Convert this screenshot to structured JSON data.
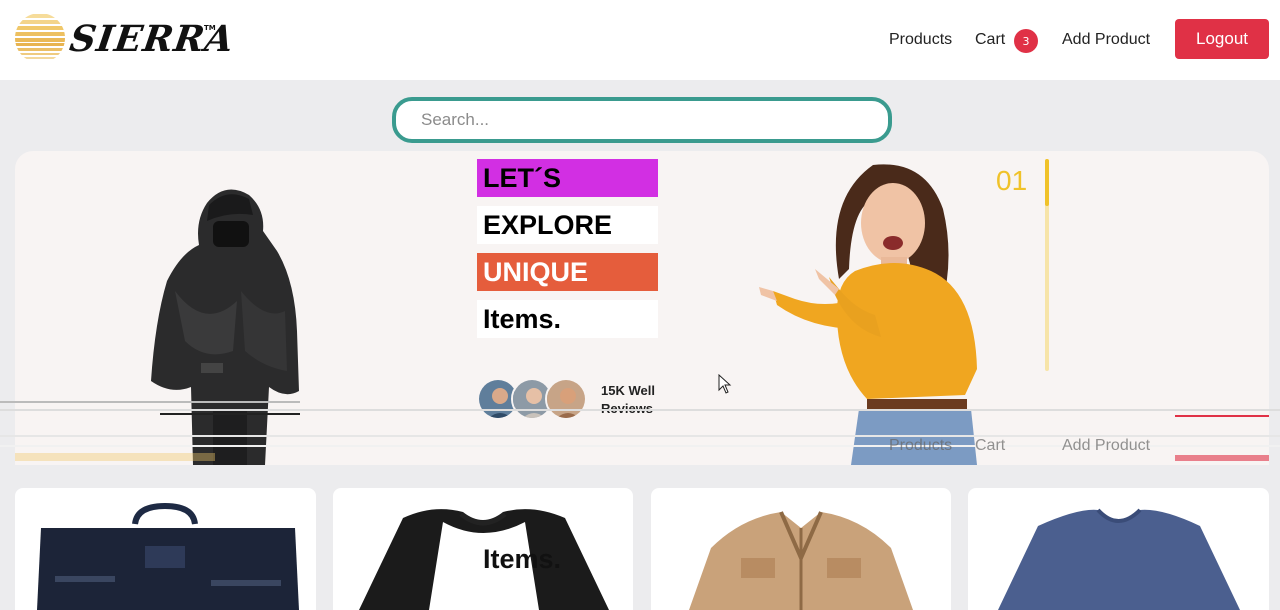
{
  "brand": {
    "name": "SIERRA",
    "trademark": "TM",
    "logo_color": "#f0c86a"
  },
  "nav": {
    "products_label": "Products",
    "cart_label": "Cart",
    "cart_count": "3",
    "add_product_label": "Add Product",
    "logout_label": "Logout"
  },
  "search": {
    "placeholder": "Search...",
    "value": ""
  },
  "hero": {
    "headline": [
      "LET´S",
      "EXPLORE",
      "UNIQUE",
      "Items."
    ],
    "reviews_line1": "15K Well",
    "reviews_line2": "Reviews",
    "slide_number": "01",
    "slide_progress": 0.22
  },
  "colors": {
    "accent_red": "#e03146",
    "accent_teal": "#3a9b8f",
    "accent_magenta": "#d22fe3",
    "accent_orange": "#e55d3c",
    "accent_yellow": "#f0c229"
  },
  "products": [
    {
      "icon": "black-bag-icon"
    },
    {
      "icon": "raglan-tshirt-icon"
    },
    {
      "icon": "beige-jacket-icon"
    },
    {
      "icon": "blue-longsleeve-icon"
    }
  ]
}
